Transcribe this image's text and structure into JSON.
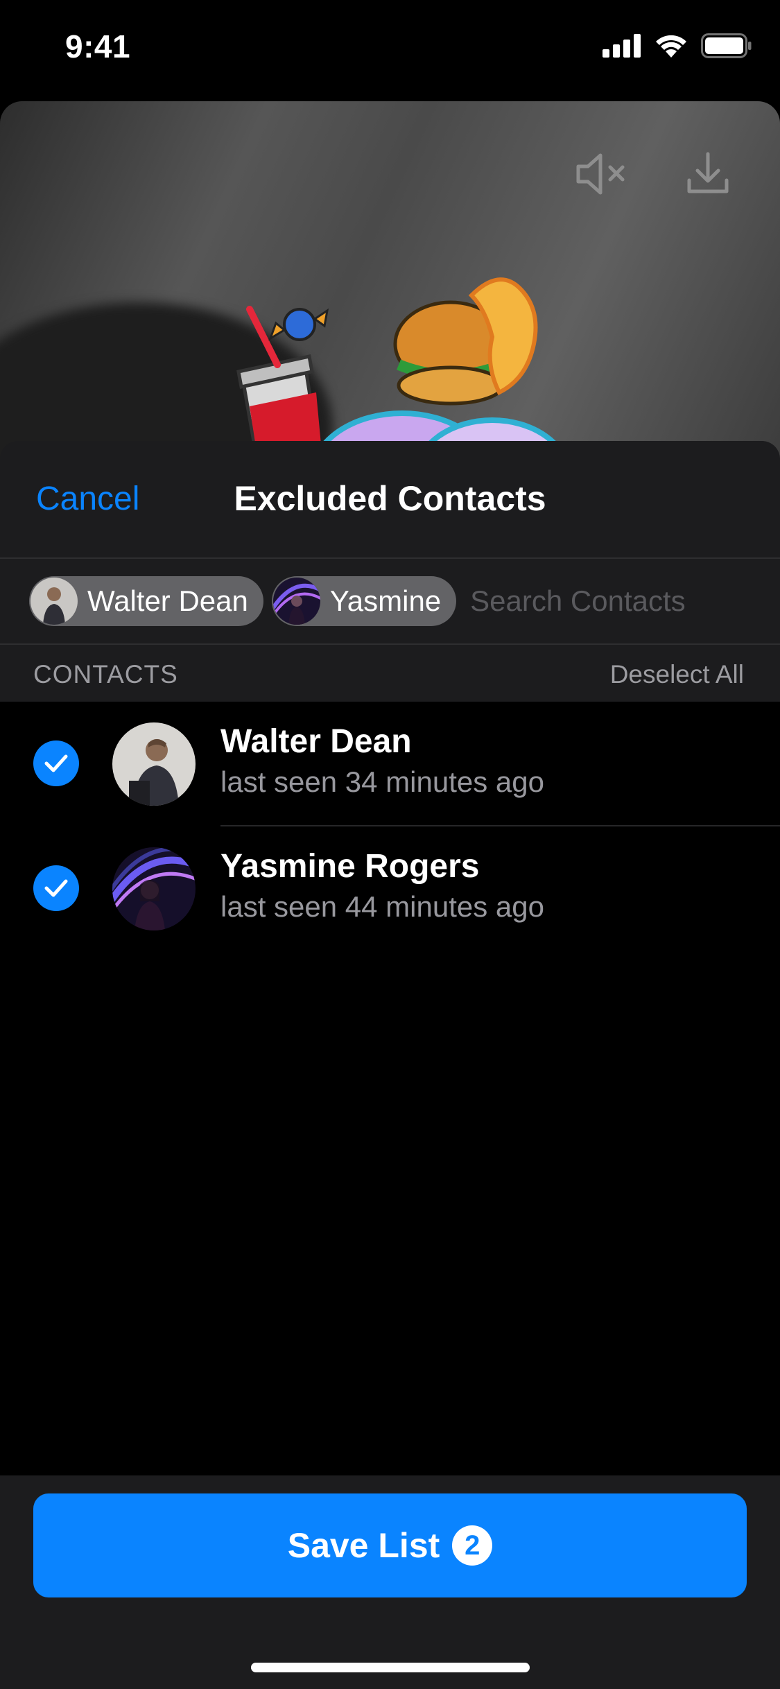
{
  "status_bar": {
    "time": "9:41"
  },
  "nav": {
    "cancel_label": "Cancel",
    "title": "Excluded Contacts"
  },
  "tokens": [
    {
      "label": "Walter Dean",
      "avatar": "walter-dean-photo"
    },
    {
      "label": "Yasmine",
      "avatar": "yasmine-rogers-photo"
    }
  ],
  "search": {
    "placeholder": "Search Contacts"
  },
  "section": {
    "title": "CONTACTS",
    "deselect_label": "Deselect All"
  },
  "contacts": [
    {
      "name": "Walter Dean",
      "status": "last seen 34 minutes ago",
      "selected": true
    },
    {
      "name": "Yasmine Rogers",
      "status": "last seen 44 minutes ago",
      "selected": true
    }
  ],
  "save": {
    "label": "Save List",
    "count": "2"
  },
  "icons": {
    "mute": "speaker-mute-icon",
    "download": "download-icon",
    "check": "checkmark-icon"
  },
  "colors": {
    "accent": "#0a84ff",
    "sheet_bg": "#1c1c1e"
  }
}
